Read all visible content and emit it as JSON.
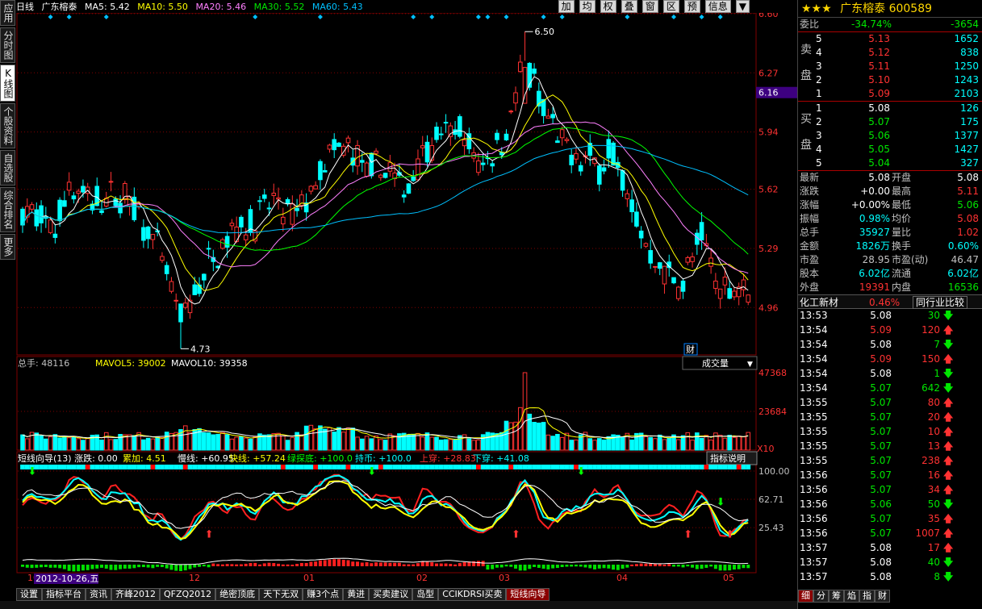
{
  "left_tabs": [
    {
      "label": "应用",
      "active": false
    },
    {
      "label": "分时图",
      "active": false
    },
    {
      "label": "K线图",
      "active": true
    },
    {
      "label": "个股资料",
      "active": false
    },
    {
      "label": "自选股",
      "active": false
    },
    {
      "label": "综合排名",
      "active": false
    },
    {
      "label": "更多",
      "active": false
    }
  ],
  "header": {
    "period": "日线",
    "stock_name": "广东榕泰",
    "ma5": "MA5: 5.42",
    "ma10": "MA10: 5.50",
    "ma20": "MA20: 5.46",
    "ma30": "MA30: 5.52",
    "ma60": "MA60: 5.43"
  },
  "toolbar": [
    "加",
    "均",
    "权",
    "叠",
    "窗",
    "区",
    "预",
    "信息",
    "▼"
  ],
  "colors": {
    "up": "#ff3232",
    "down": "#00ffff",
    "ma5": "#ffffff",
    "ma10": "#ffff00",
    "ma20": "#ff80ff",
    "ma30": "#00ff00",
    "ma60": "#00c0ff",
    "grid": "#800000"
  },
  "price_axis": {
    "labels": [
      "6.60",
      "6.27",
      "6.16",
      "5.94",
      "5.62",
      "5.29",
      "4.96"
    ],
    "min": 4.7,
    "max": 6.6,
    "current_tag": "6.16",
    "high_label": "6.50",
    "low_label": "4.73",
    "marker": "财"
  },
  "volume_panel": {
    "header_total": "总手: 48116",
    "mavol5": "MAVOL5: 39002",
    "mavol10": "MAVOL10: 39358",
    "selector": "成交量",
    "axis_labels": [
      "47368",
      "23684",
      "X10"
    ]
  },
  "indicator_panel": {
    "header": "短线向导(13) 涨跌: 0.00",
    "accum": "累加: 4.51",
    "slow": "慢线: +60.95",
    "fast": "快线: +57.24",
    "green_bottom": "绿探底: +100.0",
    "hold": "持币: +100.0",
    "up_cross": "上穿: +28.83",
    "down_cross": "下穿: +41.08",
    "help_button": "指标说明",
    "axis_labels": [
      "100.00",
      "62.71",
      "25.43"
    ]
  },
  "x_axis": {
    "labels": [
      "10",
      "12",
      "01",
      "02",
      "03",
      "04",
      "05"
    ],
    "cursor_date": "2012-10-26,五"
  },
  "bottom_tabs": [
    {
      "label": "设置",
      "active": false
    },
    {
      "label": "指标平台",
      "active": false
    },
    {
      "label": "资讯",
      "active": false
    },
    {
      "label": "齐峰2012",
      "active": false
    },
    {
      "label": "QFZQ2012",
      "active": false
    },
    {
      "label": "绝密顶底",
      "active": false
    },
    {
      "label": "天下无双",
      "active": false
    },
    {
      "label": "赚3个点",
      "active": false
    },
    {
      "label": "黄进",
      "active": false
    },
    {
      "label": "买卖建议",
      "active": false
    },
    {
      "label": "岛型",
      "active": false
    },
    {
      "label": "CCIKDRSI买卖",
      "active": false
    },
    {
      "label": "短线向导",
      "active": true
    }
  ],
  "quote": {
    "stars": "★★★",
    "name": "广东榕泰",
    "code": "600589",
    "weibi_label": "委比",
    "weibi": "-34.74%",
    "weicha": "-3654",
    "sell_label": "卖盘",
    "buy_label": "买盘",
    "sell": [
      {
        "lvl": "5",
        "price": "5.13",
        "vol": "1652"
      },
      {
        "lvl": "4",
        "price": "5.12",
        "vol": "838"
      },
      {
        "lvl": "3",
        "price": "5.11",
        "vol": "1250"
      },
      {
        "lvl": "2",
        "price": "5.10",
        "vol": "1243"
      },
      {
        "lvl": "1",
        "price": "5.09",
        "vol": "2103"
      }
    ],
    "buy": [
      {
        "lvl": "1",
        "price": "5.08",
        "vol": "126"
      },
      {
        "lvl": "2",
        "price": "5.07",
        "vol": "175"
      },
      {
        "lvl": "3",
        "price": "5.06",
        "vol": "1377"
      },
      {
        "lvl": "4",
        "price": "5.05",
        "vol": "1427"
      },
      {
        "lvl": "5",
        "price": "5.04",
        "vol": "327"
      }
    ],
    "stats": [
      {
        "l1": "最新",
        "v1": "5.08",
        "c1": "white",
        "l2": "开盘",
        "v2": "5.08",
        "c2": "white"
      },
      {
        "l1": "涨跌",
        "v1": "+0.00",
        "c1": "white",
        "l2": "最高",
        "v2": "5.11",
        "c2": "red"
      },
      {
        "l1": "涨幅",
        "v1": "+0.00%",
        "c1": "white",
        "l2": "最低",
        "v2": "5.06",
        "c2": "green"
      },
      {
        "l1": "振幅",
        "v1": "0.98%",
        "c1": "cyan",
        "l2": "均价",
        "v2": "5.08",
        "c2": "red"
      },
      {
        "l1": "总手",
        "v1": "35927",
        "c1": "cyan",
        "l2": "量比",
        "v2": "1.02",
        "c2": "red"
      },
      {
        "l1": "金额",
        "v1": "1826万",
        "c1": "cyan",
        "l2": "换手",
        "v2": "0.60%",
        "c2": "cyan"
      },
      {
        "l1": "市盈",
        "v1": "28.95",
        "c1": "grey",
        "l2": "市盈(动)",
        "v2": "46.47",
        "c2": "grey"
      },
      {
        "l1": "股本",
        "v1": "6.02亿",
        "c1": "cyan",
        "l2": "流通",
        "v2": "6.02亿",
        "c2": "cyan"
      },
      {
        "l1": "外盘",
        "v1": "19391",
        "c1": "red",
        "l2": "内盘",
        "v2": "16536",
        "c2": "green"
      }
    ],
    "sector_name": "化工新材",
    "sector_change": "0.46%",
    "sector_button": "同行业比较",
    "ticks": [
      {
        "t": "13:53",
        "p": "5.08",
        "pc": "white",
        "v": "30",
        "d": "down"
      },
      {
        "t": "13:54",
        "p": "5.09",
        "pc": "red",
        "v": "120",
        "d": "up"
      },
      {
        "t": "13:54",
        "p": "5.08",
        "pc": "white",
        "v": "7",
        "d": "down"
      },
      {
        "t": "13:54",
        "p": "5.09",
        "pc": "red",
        "v": "150",
        "d": "up"
      },
      {
        "t": "13:54",
        "p": "5.08",
        "pc": "white",
        "v": "1",
        "d": "down"
      },
      {
        "t": "13:54",
        "p": "5.07",
        "pc": "green",
        "v": "642",
        "d": "down"
      },
      {
        "t": "13:55",
        "p": "5.07",
        "pc": "green",
        "v": "80",
        "d": "up"
      },
      {
        "t": "13:55",
        "p": "5.07",
        "pc": "green",
        "v": "20",
        "d": "up"
      },
      {
        "t": "13:55",
        "p": "5.07",
        "pc": "green",
        "v": "10",
        "d": "up"
      },
      {
        "t": "13:55",
        "p": "5.07",
        "pc": "green",
        "v": "13",
        "d": "up"
      },
      {
        "t": "13:55",
        "p": "5.07",
        "pc": "green",
        "v": "238",
        "d": "up"
      },
      {
        "t": "13:56",
        "p": "5.07",
        "pc": "green",
        "v": "16",
        "d": "up"
      },
      {
        "t": "13:56",
        "p": "5.07",
        "pc": "green",
        "v": "34",
        "d": "up"
      },
      {
        "t": "13:56",
        "p": "5.06",
        "pc": "green",
        "v": "50",
        "d": "down"
      },
      {
        "t": "13:56",
        "p": "5.07",
        "pc": "green",
        "v": "35",
        "d": "up"
      },
      {
        "t": "13:56",
        "p": "5.07",
        "pc": "green",
        "v": "1007",
        "d": "up"
      },
      {
        "t": "13:57",
        "p": "5.08",
        "pc": "white",
        "v": "17",
        "d": "up"
      },
      {
        "t": "13:57",
        "p": "5.08",
        "pc": "white",
        "v": "40",
        "d": "down"
      },
      {
        "t": "13:57",
        "p": "5.08",
        "pc": "white",
        "v": "8",
        "d": "down"
      }
    ],
    "bottom_tabs": [
      "细",
      "分",
      "筹",
      "焰",
      "指",
      "财"
    ]
  },
  "chart_data": {
    "type": "candlestick",
    "price_range": [
      4.7,
      6.6
    ],
    "high": 6.5,
    "low": 4.73,
    "volume_max": 47368,
    "indicator_range": [
      0,
      100
    ]
  }
}
